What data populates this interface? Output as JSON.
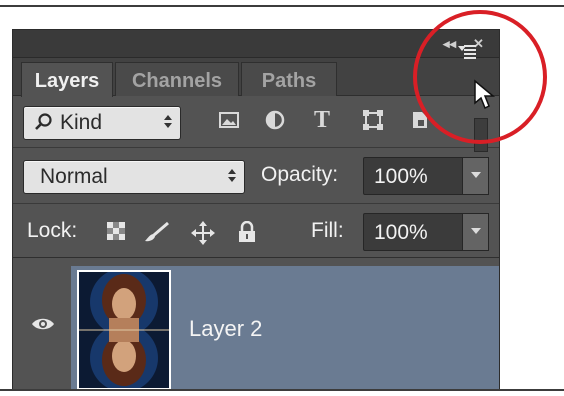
{
  "window": {
    "collapse_glyph": "◂◂",
    "close_glyph": "✕"
  },
  "tabs": [
    {
      "label": "Layers",
      "active": true
    },
    {
      "label": "Channels",
      "active": false
    },
    {
      "label": "Paths",
      "active": false
    }
  ],
  "filter": {
    "kind_label": "Kind",
    "kind_icon": "search-icon",
    "type_icons": [
      "image-filter-icon",
      "adjustment-filter-icon",
      "type-filter-icon",
      "shape-filter-icon",
      "smart-object-filter-icon"
    ],
    "type_glyph": "T"
  },
  "blend": {
    "mode": "Normal",
    "opacity_label": "Opacity:",
    "opacity_value": "100%"
  },
  "lock": {
    "label": "Lock:",
    "icons": [
      "lock-transparent-pixels-icon",
      "lock-image-pixels-icon",
      "lock-position-icon",
      "lock-all-icon"
    ],
    "fill_label": "Fill:",
    "fill_value": "100%"
  },
  "layers": [
    {
      "name": "Layer 2",
      "visible": true,
      "selected": true
    }
  ],
  "colors": {
    "panel_bg": "#535353",
    "selected_row": "#6a7b92",
    "highlight_ring": "#d91f26"
  }
}
